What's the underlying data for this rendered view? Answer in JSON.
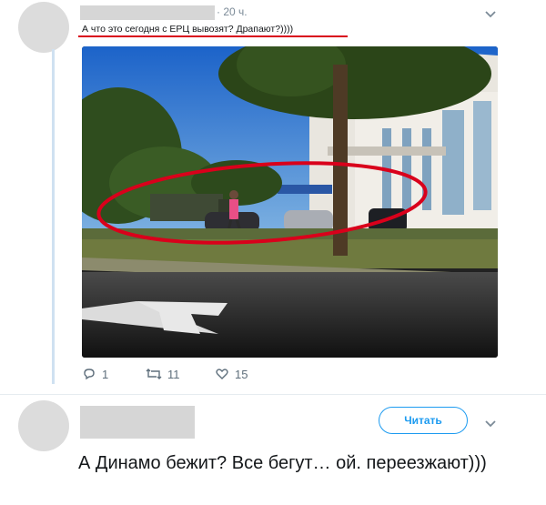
{
  "tweet": {
    "time": "· 20 ч.",
    "text": "А что это сегодня с ЕРЦ вывозят? Драпают?))))",
    "menu_icon": "chevron-down-icon",
    "actions": {
      "reply_count": "1",
      "retweet_count": "11",
      "like_count": "15"
    }
  },
  "reply": {
    "follow_label": "Читать",
    "text": "А Динамо бежит? Все бегут… ой. переезжают)))",
    "menu_icon": "chevron-down-icon"
  },
  "colors": {
    "annotation_red": "#d9001b",
    "link_blue": "#1d9bf0",
    "muted": "#7b8a97"
  }
}
